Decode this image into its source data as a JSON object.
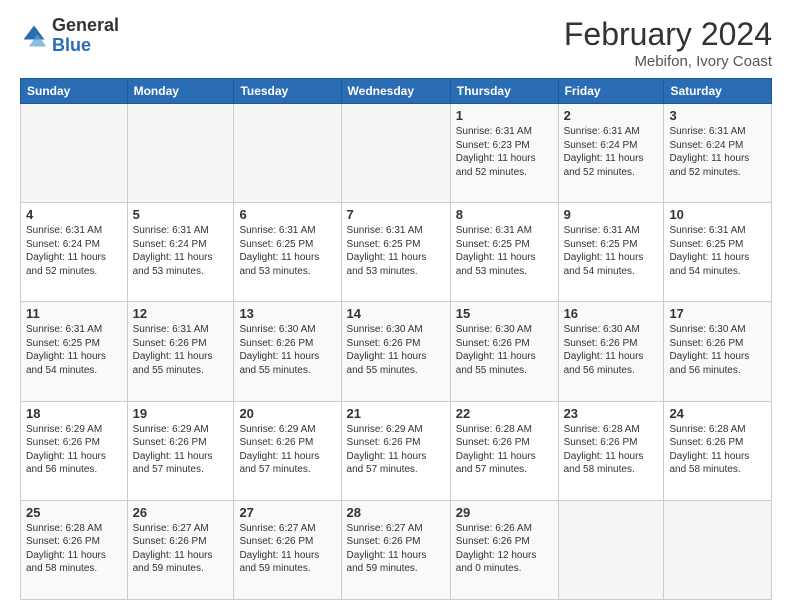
{
  "header": {
    "logo": {
      "line1": "General",
      "line2": "Blue"
    },
    "month_year": "February 2024",
    "location": "Mebifon, Ivory Coast"
  },
  "days_of_week": [
    "Sunday",
    "Monday",
    "Tuesday",
    "Wednesday",
    "Thursday",
    "Friday",
    "Saturday"
  ],
  "weeks": [
    [
      {
        "day": "",
        "info": ""
      },
      {
        "day": "",
        "info": ""
      },
      {
        "day": "",
        "info": ""
      },
      {
        "day": "",
        "info": ""
      },
      {
        "day": "1",
        "info": "Sunrise: 6:31 AM\nSunset: 6:23 PM\nDaylight: 11 hours\nand 52 minutes."
      },
      {
        "day": "2",
        "info": "Sunrise: 6:31 AM\nSunset: 6:24 PM\nDaylight: 11 hours\nand 52 minutes."
      },
      {
        "day": "3",
        "info": "Sunrise: 6:31 AM\nSunset: 6:24 PM\nDaylight: 11 hours\nand 52 minutes."
      }
    ],
    [
      {
        "day": "4",
        "info": "Sunrise: 6:31 AM\nSunset: 6:24 PM\nDaylight: 11 hours\nand 52 minutes."
      },
      {
        "day": "5",
        "info": "Sunrise: 6:31 AM\nSunset: 6:24 PM\nDaylight: 11 hours\nand 53 minutes."
      },
      {
        "day": "6",
        "info": "Sunrise: 6:31 AM\nSunset: 6:25 PM\nDaylight: 11 hours\nand 53 minutes."
      },
      {
        "day": "7",
        "info": "Sunrise: 6:31 AM\nSunset: 6:25 PM\nDaylight: 11 hours\nand 53 minutes."
      },
      {
        "day": "8",
        "info": "Sunrise: 6:31 AM\nSunset: 6:25 PM\nDaylight: 11 hours\nand 53 minutes."
      },
      {
        "day": "9",
        "info": "Sunrise: 6:31 AM\nSunset: 6:25 PM\nDaylight: 11 hours\nand 54 minutes."
      },
      {
        "day": "10",
        "info": "Sunrise: 6:31 AM\nSunset: 6:25 PM\nDaylight: 11 hours\nand 54 minutes."
      }
    ],
    [
      {
        "day": "11",
        "info": "Sunrise: 6:31 AM\nSunset: 6:25 PM\nDaylight: 11 hours\nand 54 minutes."
      },
      {
        "day": "12",
        "info": "Sunrise: 6:31 AM\nSunset: 6:26 PM\nDaylight: 11 hours\nand 55 minutes."
      },
      {
        "day": "13",
        "info": "Sunrise: 6:30 AM\nSunset: 6:26 PM\nDaylight: 11 hours\nand 55 minutes."
      },
      {
        "day": "14",
        "info": "Sunrise: 6:30 AM\nSunset: 6:26 PM\nDaylight: 11 hours\nand 55 minutes."
      },
      {
        "day": "15",
        "info": "Sunrise: 6:30 AM\nSunset: 6:26 PM\nDaylight: 11 hours\nand 55 minutes."
      },
      {
        "day": "16",
        "info": "Sunrise: 6:30 AM\nSunset: 6:26 PM\nDaylight: 11 hours\nand 56 minutes."
      },
      {
        "day": "17",
        "info": "Sunrise: 6:30 AM\nSunset: 6:26 PM\nDaylight: 11 hours\nand 56 minutes."
      }
    ],
    [
      {
        "day": "18",
        "info": "Sunrise: 6:29 AM\nSunset: 6:26 PM\nDaylight: 11 hours\nand 56 minutes."
      },
      {
        "day": "19",
        "info": "Sunrise: 6:29 AM\nSunset: 6:26 PM\nDaylight: 11 hours\nand 57 minutes."
      },
      {
        "day": "20",
        "info": "Sunrise: 6:29 AM\nSunset: 6:26 PM\nDaylight: 11 hours\nand 57 minutes."
      },
      {
        "day": "21",
        "info": "Sunrise: 6:29 AM\nSunset: 6:26 PM\nDaylight: 11 hours\nand 57 minutes."
      },
      {
        "day": "22",
        "info": "Sunrise: 6:28 AM\nSunset: 6:26 PM\nDaylight: 11 hours\nand 57 minutes."
      },
      {
        "day": "23",
        "info": "Sunrise: 6:28 AM\nSunset: 6:26 PM\nDaylight: 11 hours\nand 58 minutes."
      },
      {
        "day": "24",
        "info": "Sunrise: 6:28 AM\nSunset: 6:26 PM\nDaylight: 11 hours\nand 58 minutes."
      }
    ],
    [
      {
        "day": "25",
        "info": "Sunrise: 6:28 AM\nSunset: 6:26 PM\nDaylight: 11 hours\nand 58 minutes."
      },
      {
        "day": "26",
        "info": "Sunrise: 6:27 AM\nSunset: 6:26 PM\nDaylight: 11 hours\nand 59 minutes."
      },
      {
        "day": "27",
        "info": "Sunrise: 6:27 AM\nSunset: 6:26 PM\nDaylight: 11 hours\nand 59 minutes."
      },
      {
        "day": "28",
        "info": "Sunrise: 6:27 AM\nSunset: 6:26 PM\nDaylight: 11 hours\nand 59 minutes."
      },
      {
        "day": "29",
        "info": "Sunrise: 6:26 AM\nSunset: 6:26 PM\nDaylight: 12 hours\nand 0 minutes."
      },
      {
        "day": "",
        "info": ""
      },
      {
        "day": "",
        "info": ""
      }
    ]
  ],
  "accent_color": "#2a6db5"
}
